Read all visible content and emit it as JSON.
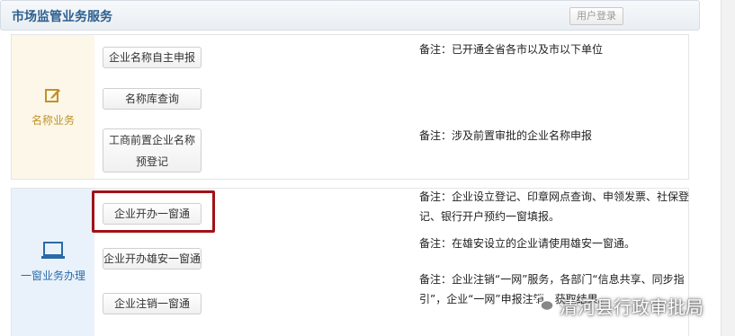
{
  "header": {
    "title": "市场监管业务服务",
    "login_label": "用户登录"
  },
  "sections": [
    {
      "category": "名称业务",
      "buttons": [
        "企业名称自主申报",
        "名称库查询",
        "工商前置企业名称预登记"
      ],
      "notes": [
        "备注：已开通全省各市以及市以下单位",
        "备注：涉及前置审批的企业名称申报"
      ]
    },
    {
      "category": "一窗业务办理",
      "buttons": [
        "企业开办一窗通",
        "企业开办雄安一窗通",
        "企业注销一窗通"
      ],
      "notes": [
        "备注：企业设立登记、印章网点查询、申领发票、社保登记、银行开户预约一窗填报。",
        "备注：在雄安设立的企业请使用雄安一窗通。",
        "备注：企业注销“一网”服务，各部门“信息共享、同步指引”，企业“一网”申报注销，获取结果。"
      ]
    }
  ],
  "watermark": "清河县行政审批局",
  "colors": {
    "highlight": "#a1121a",
    "title": "#2b5f8e",
    "name_accent": "#c0922a",
    "window_accent": "#2a6aa8"
  }
}
